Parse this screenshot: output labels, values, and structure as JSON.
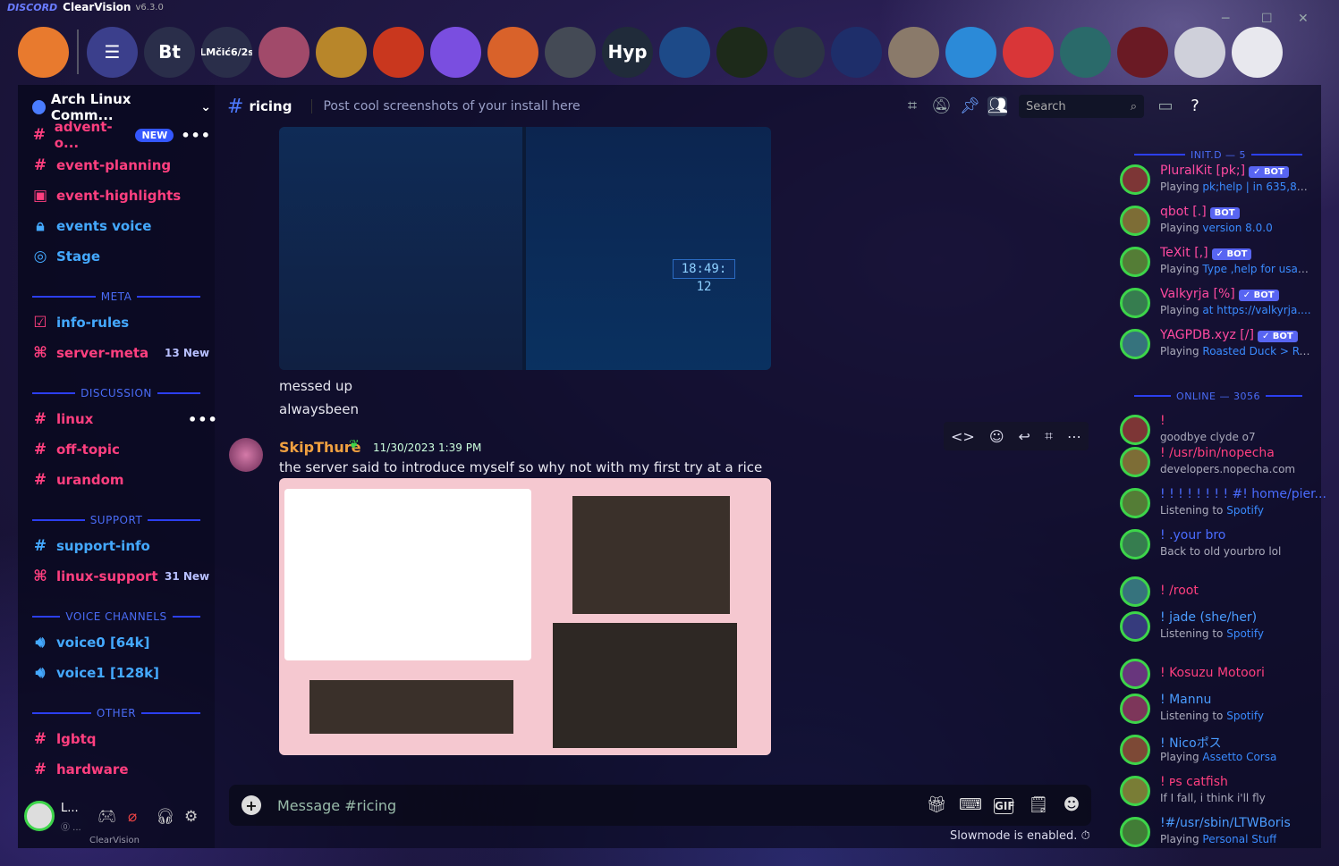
{
  "app": {
    "brand": "DISCORD",
    "title": "ClearVision",
    "version": "v6.3.0"
  },
  "window": {
    "minimize": "─",
    "maximize": "☐",
    "close": "✕"
  },
  "guilds": [
    {
      "name": "server-1",
      "label": "",
      "color": "#e87a2e"
    },
    {
      "name": "home",
      "label": "☰",
      "color": "#3b3f8c"
    },
    {
      "name": "bt",
      "label": "Bt",
      "color": "#2a2e4a"
    },
    {
      "name": "lmcic",
      "label": "LMčić6/2s",
      "color": "#2a2e4a"
    },
    {
      "name": "server-5",
      "label": "",
      "color": "#a14a6a"
    },
    {
      "name": "server-6",
      "label": "",
      "color": "#b8862a"
    },
    {
      "name": "server-7",
      "label": "",
      "color": "#c9371e"
    },
    {
      "name": "folder",
      "label": "",
      "color": "#7a4ee0"
    },
    {
      "name": "server-9",
      "label": "",
      "color": "#d9622a"
    },
    {
      "name": "arch",
      "label": "",
      "color": "#444a55"
    },
    {
      "name": "hypr",
      "label": "Hyp",
      "color": "#202b3a"
    },
    {
      "name": "server-12",
      "label": "",
      "color": "#1d4a88"
    },
    {
      "name": "server-13",
      "label": "",
      "color": "#1d2a1a"
    },
    {
      "name": "server-14",
      "label": "",
      "color": "#2c3444"
    },
    {
      "name": "server-15",
      "label": "",
      "color": "#1e2e6a"
    },
    {
      "name": "server-16",
      "label": "",
      "color": "#8a7a6a"
    },
    {
      "name": "server-17",
      "label": "",
      "color": "#2b8ad8"
    },
    {
      "name": "server-18",
      "label": "",
      "color": "#d93638"
    },
    {
      "name": "server-19",
      "label": "",
      "color": "#2a6a6a"
    },
    {
      "name": "server-20",
      "label": "",
      "color": "#6a1a24"
    },
    {
      "name": "server-21",
      "label": "",
      "color": "#cfd0da"
    },
    {
      "name": "server-22",
      "label": "",
      "color": "#e8e8ee"
    }
  ],
  "server": {
    "name": "Arch Linux Comm...",
    "chevron": "⌄"
  },
  "channels": {
    "advent": {
      "name": "advent-o...",
      "badge": "NEW",
      "more": "•••"
    },
    "event_planning": "event-planning",
    "event_highlights": "event-highlights",
    "events_voice": "events voice",
    "stage": "Stage",
    "cat_meta": "META",
    "info_rules": "info-rules",
    "server_meta": {
      "name": "server-meta",
      "new": "13 New"
    },
    "cat_discussion": "DISCUSSION",
    "linux": {
      "name": "linux",
      "more": "•••"
    },
    "off_topic": "off-topic",
    "urandom": "urandom",
    "cat_support": "SUPPORT",
    "support_info": "support-info",
    "linux_support": {
      "name": "linux-support",
      "new": "31 New"
    },
    "cat_voice": "VOICE CHANNELS",
    "voice0": "voice0 [64k]",
    "voice1": "voice1 [128k]",
    "cat_other": "OTHER",
    "lgbtq": "lgbtq",
    "hardware": "hardware"
  },
  "header": {
    "hash": "#",
    "channel": "ricing",
    "topic": "Post cool screenshots of your install here",
    "search_placeholder": "Search"
  },
  "messages": {
    "line1": "messed up",
    "line2": "alwaysbeen",
    "author": "SkipThure",
    "timestamp": "11/30/2023 1:39 PM",
    "text": "the server said to introduce myself so why not with my first try at a rice",
    "clock": "18:49: 12"
  },
  "composer": {
    "placeholder": "Message #ricing",
    "gif": "GIF",
    "slowmode": "Slowmode is enabled."
  },
  "member_categories": {
    "init": "INIT.D — 5",
    "online": "ONLINE — 3056"
  },
  "bots": [
    {
      "name": "PluralKit [pk;]",
      "badge": "✓ BOT",
      "status_pre": "Playing ",
      "status": "pk;help | in 635,84..."
    },
    {
      "name": "qbot [.]",
      "badge": "BOT",
      "status_pre": "Playing ",
      "status": "version 8.0.0"
    },
    {
      "name": "TeXit [,]",
      "badge": "✓ BOT",
      "status_pre": "Playing ",
      "status": "Type ,help for usage!"
    },
    {
      "name": "Valkyrja [%]",
      "badge": "✓ BOT",
      "status_pre": "Playing ",
      "status": "at https://valkyrja...."
    },
    {
      "name": "YAGPDB.xyz [/]",
      "badge": "✓ BOT",
      "status_pre": "Playing ",
      "status": "Roasted Duck > Ro..."
    }
  ],
  "online": [
    {
      "name": "!",
      "status": "goodbye clyde o7"
    },
    {
      "name": "! /usr/bin/nopecha",
      "status": "developers.nopecha.com"
    },
    {
      "name": "! ! ! ! ! ! ! ! #! home/pier...",
      "status_pre": "Listening to ",
      "status": "Spotify"
    },
    {
      "name": "! .your bro",
      "status": "Back to old yourbro lol"
    },
    {
      "name": "! /root",
      "status": ""
    },
    {
      "name": "! jade (she/her)",
      "status_pre": "Listening to ",
      "status": "Spotify"
    },
    {
      "name": "! Kosuzu Motoori",
      "status": ""
    },
    {
      "name": "! Mannu",
      "status_pre": "Listening to ",
      "status": "Spotify"
    },
    {
      "name": "! Nicoポス",
      "status_pre": "Playing ",
      "status": "Assetto Corsa"
    },
    {
      "name": "! ᴘs catfish",
      "status": "If I fall, i think i'll fly"
    },
    {
      "name": "!#/usr/sbin/LTWBoris",
      "status_pre": "Playing ",
      "status": "Personal Stuff"
    }
  ],
  "user": {
    "name": "L...",
    "status": "⓪ ...",
    "footer": "ClearVision"
  },
  "colors": {
    "accent": "#3457ff",
    "channel_pink": "#ff3f7f",
    "channel_blue": "#44a9ff",
    "online": "#3dd54a"
  }
}
